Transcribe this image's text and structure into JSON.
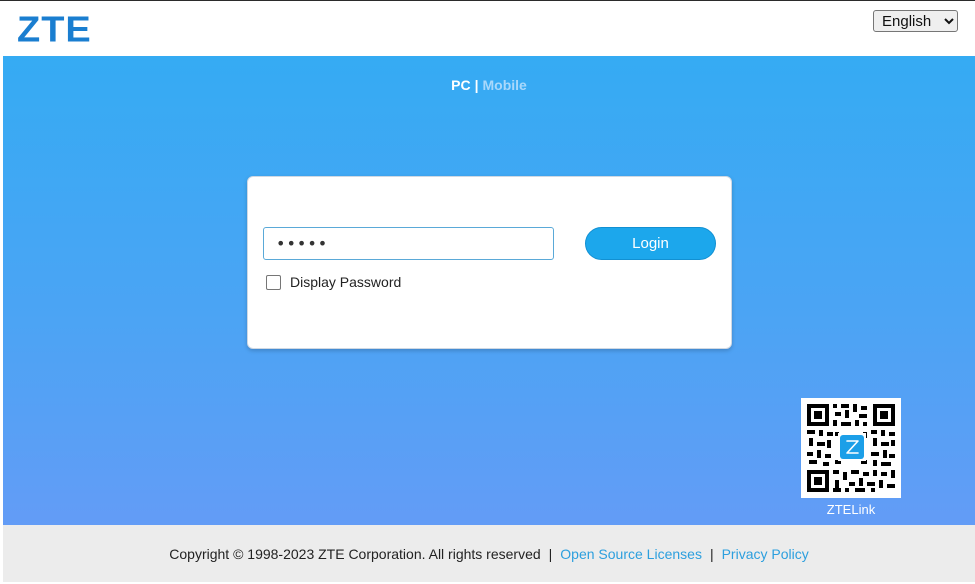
{
  "header": {
    "logo_text": "ZTE",
    "language": {
      "selected": "English",
      "options": [
        "English"
      ]
    }
  },
  "view_switch": {
    "pc_label": "PC",
    "separator": "|",
    "mobile_label": "Mobile"
  },
  "login": {
    "password_value": "•••••",
    "login_button_label": "Login",
    "display_password_label": "Display Password"
  },
  "qr": {
    "label": "ZTELink",
    "icon": "qr-code-icon"
  },
  "footer": {
    "copyright": "Copyright © 1998-2023 ZTE Corporation. All rights reserved",
    "sep1": "|",
    "open_source_label": "Open Source Licenses",
    "sep2": "|",
    "privacy_label": "Privacy Policy"
  },
  "colors": {
    "brand": "#1a7ed0",
    "hero_top": "#35abf3",
    "hero_bottom": "#639cf6",
    "button": "#1ca7ec",
    "link": "#2c9fde"
  }
}
